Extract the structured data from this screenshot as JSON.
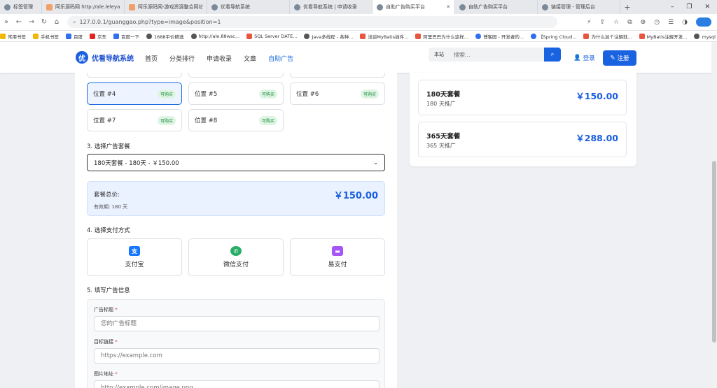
{
  "browser": {
    "tabs": [
      {
        "label": "标签管理",
        "active": false
      },
      {
        "label": "阿乐源码网 http://ale.leleyangg...",
        "active": false
      },
      {
        "label": "阿乐源码网-游戏资源整合网站,有...",
        "active": false
      },
      {
        "label": "优看导航系统",
        "active": false
      },
      {
        "label": "优看导航系统 | 申请收录",
        "active": false
      },
      {
        "label": "自助广告购买平台",
        "active": true
      },
      {
        "label": "自助广告购买平台",
        "active": false
      },
      {
        "label": "链接管理 - 管理后台",
        "active": false
      }
    ],
    "new_tab": "+",
    "url": "127.0.0.1/guanggao.php?type=image&position=1",
    "window_controls": [
      "–",
      "❐",
      "✕"
    ],
    "bookmarks": [
      "常用书签",
      "手机书签",
      "百度",
      "京东",
      "百度一下",
      "1688平价精选",
      "http://ale.88wsc...",
      "SQL Server DATE...",
      "Java多线程 - 各种...",
      "浅谈MyBatis插件...",
      "阿里巴巴为什么这样...",
      "博客园 - 开发者的...",
      "【Spring Cloud...",
      "为什么加个注解就...",
      "MyBatis注解开发...",
      "mysql 中 order..."
    ]
  },
  "site": {
    "logo_mark": "优",
    "logo_text": "优看导航系统",
    "nav": [
      "首页",
      "分类排行",
      "申请收录",
      "文章",
      "自助广告"
    ],
    "active_nav": "自助广告",
    "search_scope": "本站",
    "search_placeholder": "搜索...",
    "login": "登录",
    "register": "注册"
  },
  "positions": [
    {
      "label": "位置 #4",
      "badge": "可购买",
      "selected": true
    },
    {
      "label": "位置 #5",
      "badge": "可购买",
      "selected": false
    },
    {
      "label": "位置 #6",
      "badge": "可购买",
      "selected": false
    },
    {
      "label": "位置 #7",
      "badge": "可购买",
      "selected": false
    },
    {
      "label": "位置 #8",
      "badge": "可购买",
      "selected": false
    }
  ],
  "step3": {
    "title": "3. 选择广告套餐",
    "selected": "180天套餐 - 180天 - ￥150.00"
  },
  "total": {
    "label": "套餐总价:",
    "price": "￥150.00",
    "validity": "有效期: 180 天"
  },
  "step4": {
    "title": "4. 选择支付方式",
    "methods": [
      {
        "label": "支付宝",
        "icon": "alipay-icon",
        "color": "#1677ff",
        "glyph": "支"
      },
      {
        "label": "微信支付",
        "icon": "wechat-icon",
        "color": "#2aae67",
        "glyph": "✆"
      },
      {
        "label": "易支付",
        "icon": "card-icon",
        "color": "#a855f7",
        "glyph": "▬"
      }
    ]
  },
  "step5": {
    "title": "5. 填写广告信息",
    "fields": [
      {
        "label": "广告标题",
        "required": "*",
        "placeholder": "您的广告标题"
      },
      {
        "label": "目标链接",
        "required": "*",
        "placeholder": "https://example.com"
      },
      {
        "label": "图片地址",
        "required": "*",
        "placeholder": "http://example.com/image.png"
      }
    ]
  },
  "packages": [
    {
      "name": "180天套餐",
      "duration": "180 天推广",
      "price": "￥150.00"
    },
    {
      "name": "365天套餐",
      "duration": "365 天推广",
      "price": "￥288.00"
    }
  ],
  "colors": {
    "accent": "#1a63e0",
    "badge_bg": "#dff5e4",
    "badge_fg": "#1a8a3a"
  }
}
